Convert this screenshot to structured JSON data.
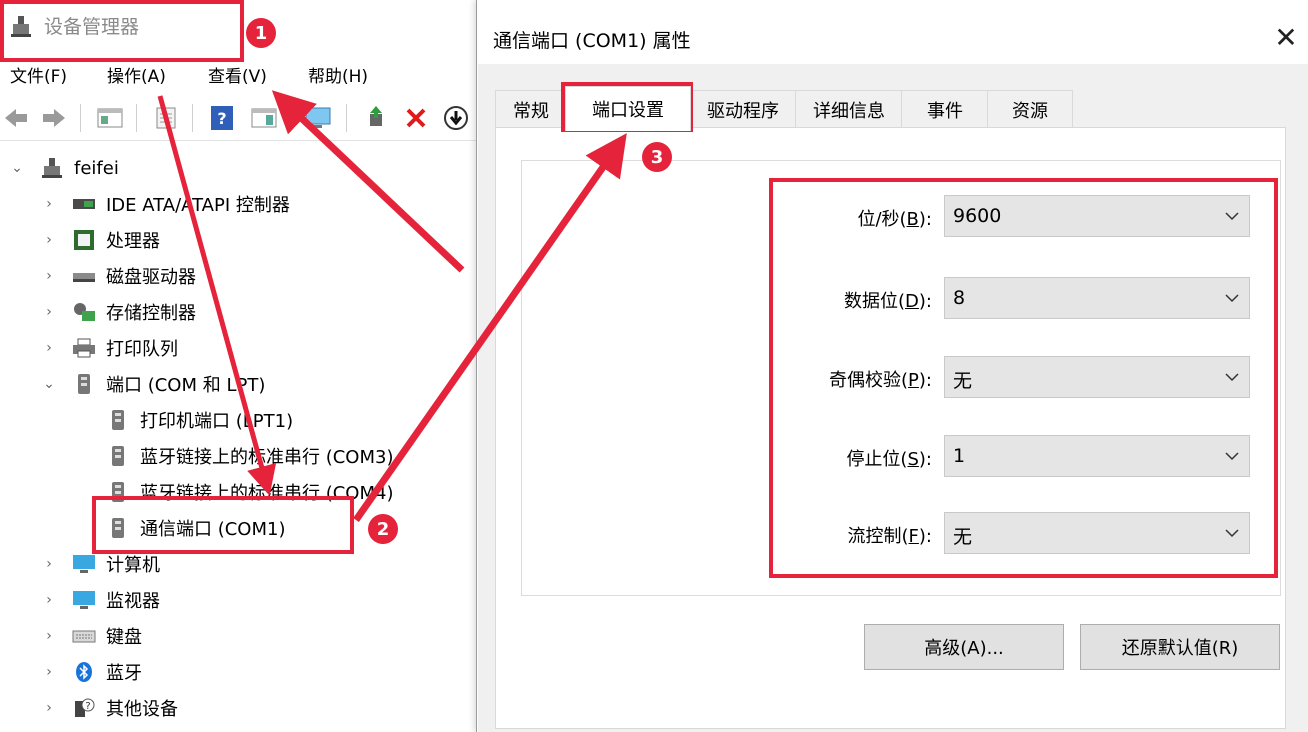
{
  "device_manager": {
    "title": "设备管理器",
    "menu": [
      {
        "label": "文件(F)"
      },
      {
        "label": "操作(A)"
      },
      {
        "label": "查看(V)"
      },
      {
        "label": "帮助(H)"
      }
    ],
    "tree": {
      "root": "feifei",
      "items": [
        {
          "label": "IDE ATA/ATAPI 控制器"
        },
        {
          "label": "处理器"
        },
        {
          "label": "磁盘驱动器"
        },
        {
          "label": "存储控制器"
        },
        {
          "label": "打印队列"
        },
        {
          "label": "端口 (COM 和 LPT)"
        },
        {
          "label": "计算机"
        },
        {
          "label": "监视器"
        },
        {
          "label": "键盘"
        },
        {
          "label": "蓝牙"
        },
        {
          "label": "其他设备"
        }
      ],
      "ports_children": [
        {
          "label": "打印机端口 (LPT1)"
        },
        {
          "label": "蓝牙链接上的标准串行 (COM3)"
        },
        {
          "label": "蓝牙链接上的标准串行 (COM4)"
        },
        {
          "label": "通信端口 (COM1)"
        }
      ]
    }
  },
  "dialog": {
    "title": "通信端口 (COM1) 属性",
    "close_glyph": "✕",
    "tabs": [
      {
        "label": "常规"
      },
      {
        "label": "端口设置"
      },
      {
        "label": "驱动程序"
      },
      {
        "label": "详细信息"
      },
      {
        "label": "事件"
      },
      {
        "label": "资源"
      }
    ],
    "settings": [
      {
        "label": "位/秒(",
        "key": "B",
        "label_end": "):",
        "value": "9600"
      },
      {
        "label": "数据位(",
        "key": "D",
        "label_end": "):",
        "value": "8"
      },
      {
        "label": "奇偶校验(",
        "key": "P",
        "label_end": "):",
        "value": "无"
      },
      {
        "label": "停止位(",
        "key": "S",
        "label_end": "):",
        "value": "1"
      },
      {
        "label": "流控制(",
        "key": "F",
        "label_end": "):",
        "value": "无"
      }
    ],
    "buttons": {
      "advanced": "高级(A)...",
      "restore_defaults": "还原默认值(R)"
    }
  },
  "annotations": {
    "badges": [
      "1",
      "2",
      "3"
    ],
    "color": "#e5233a"
  }
}
